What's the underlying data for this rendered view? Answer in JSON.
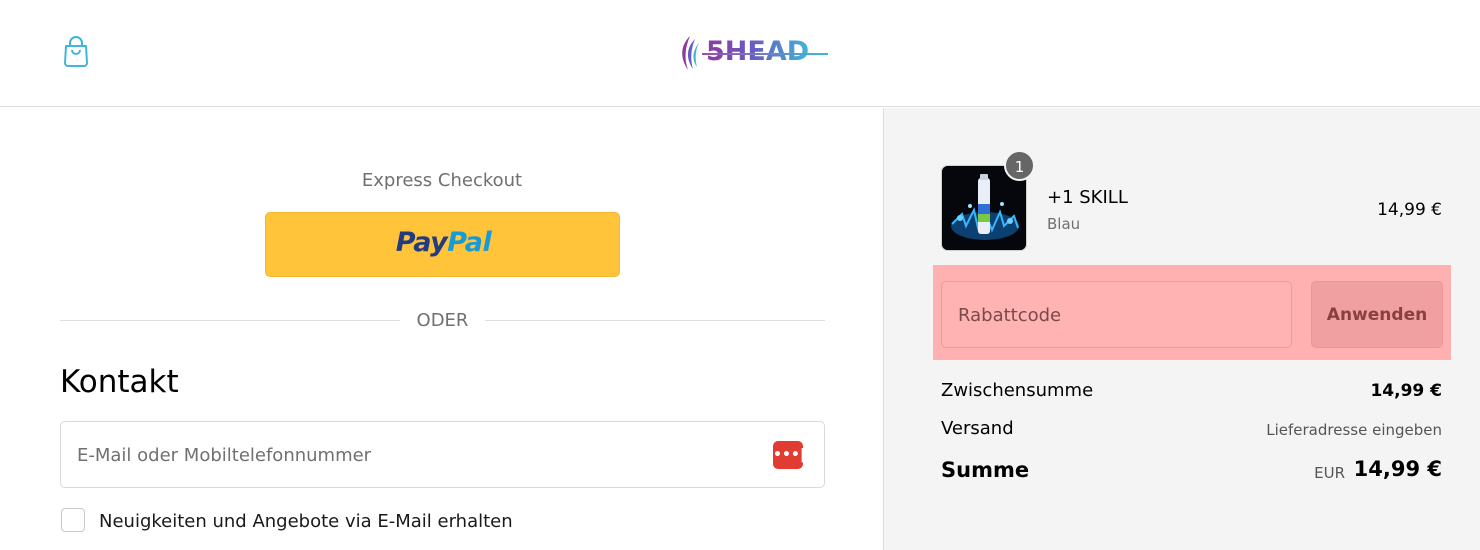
{
  "header": {
    "logo_text": "5HEAD",
    "cart_icon": "shopping-bag-icon"
  },
  "express": {
    "label": "Express Checkout",
    "paypal": {
      "part1": "Pay",
      "part2": "Pal"
    },
    "divider_text": "ODER"
  },
  "contact": {
    "title": "Kontakt",
    "email_placeholder": "E-Mail oder Mobiltelefonnummer",
    "password_manager_icon": "password-manager-icon",
    "password_manager_glyph": "•••|",
    "newsletter_label": "Neuigkeiten und Angebote via E-Mail erhalten",
    "newsletter_checked": false
  },
  "order": {
    "item": {
      "quantity": "1",
      "name": "+1 SKILL",
      "variant": "Blau",
      "price": "14,99 €"
    },
    "discount": {
      "placeholder": "Rabattcode",
      "apply_label": "Anwenden"
    },
    "subtotal": {
      "label": "Zwischensumme",
      "value": "14,99 €"
    },
    "shipping": {
      "label": "Versand",
      "value": "Lieferadresse eingeben"
    },
    "total": {
      "label": "Summe",
      "currency": "EUR",
      "value": "14,99 €"
    }
  },
  "colors": {
    "paypal_yellow": "#ffc439",
    "paypal_dark_blue": "#253b80",
    "paypal_light_blue": "#179bd7",
    "highlight": "#ffb0b0",
    "cart_icon": "#3fb6d8"
  }
}
